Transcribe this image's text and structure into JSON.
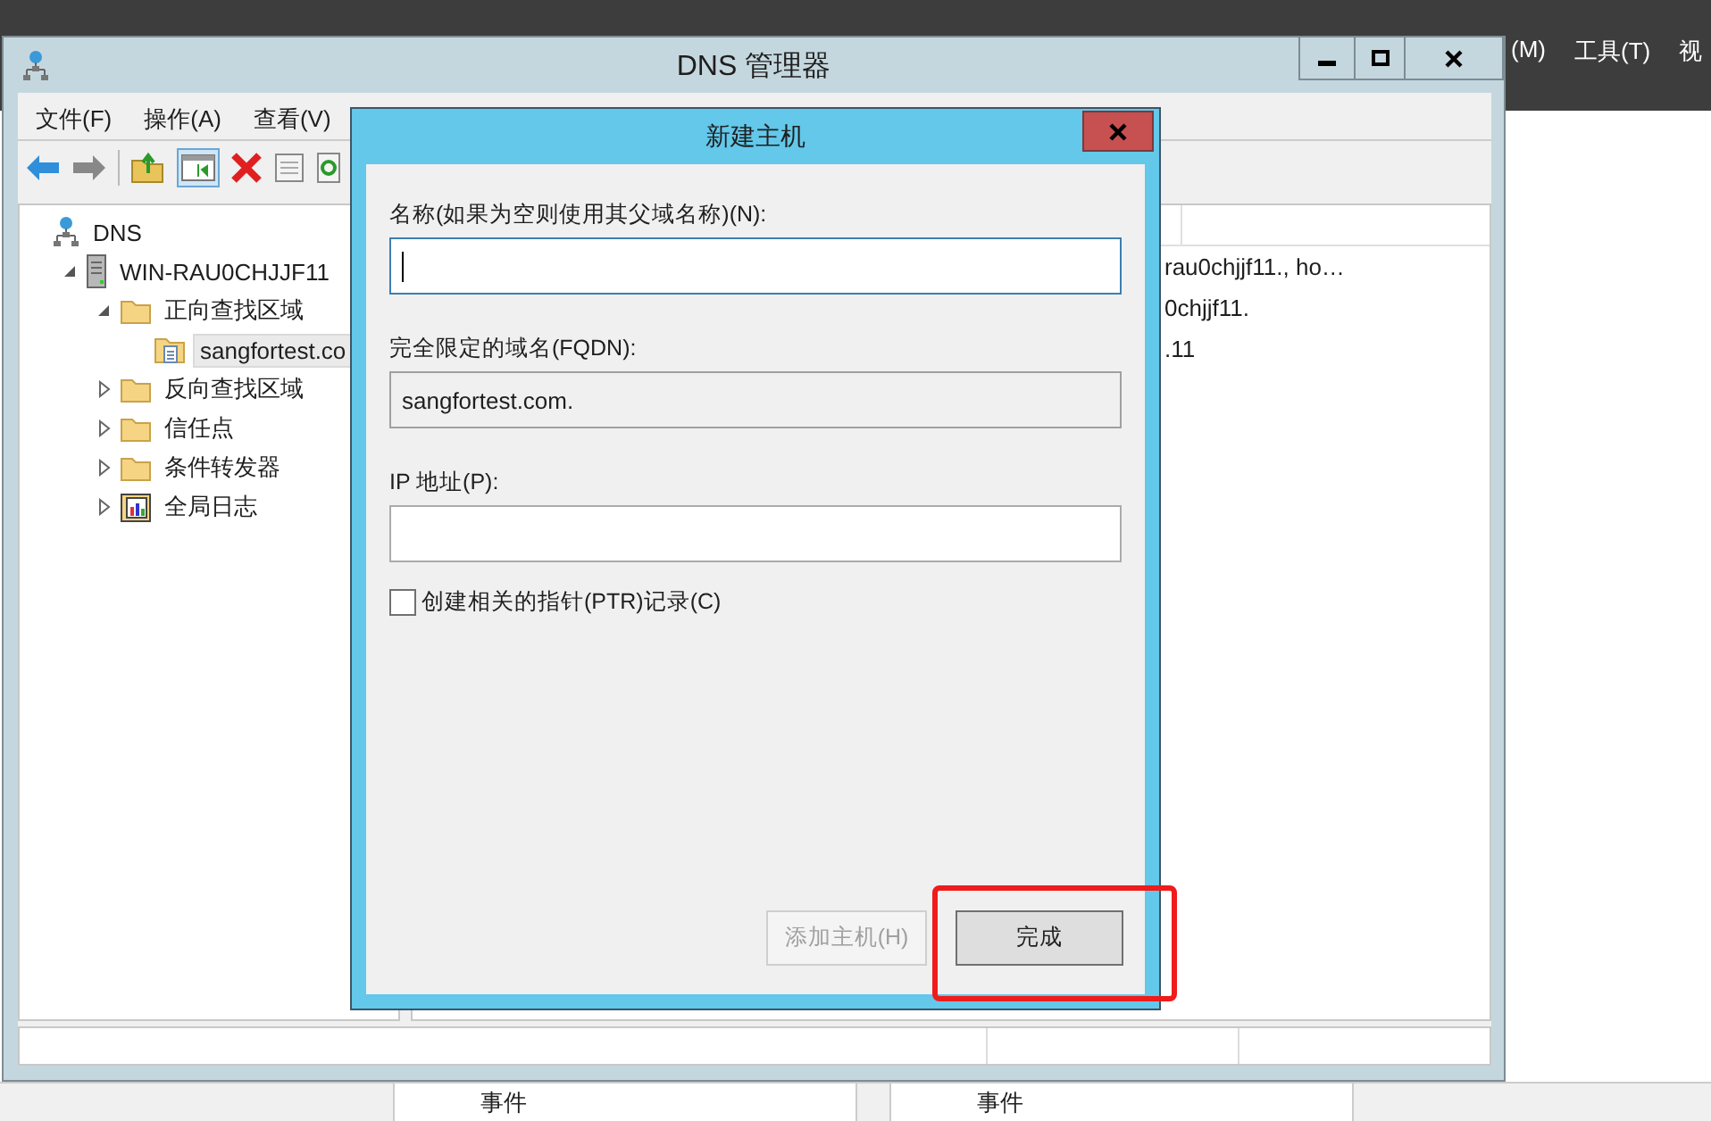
{
  "background_app": {
    "menu": [
      "(M)",
      "工具(T)",
      "视"
    ]
  },
  "window": {
    "title": "DNS 管理器"
  },
  "menu": [
    {
      "label": "文件(F)"
    },
    {
      "label": "操作(A)"
    },
    {
      "label": "查看(V)"
    }
  ],
  "tree": [
    {
      "label": "DNS",
      "kind": "dns",
      "children": [
        {
          "label": "WIN-RAU0CHJJF11",
          "kind": "server",
          "expanded": true,
          "children": [
            {
              "label": "正向查找区域",
              "kind": "folder",
              "expanded": true,
              "children": [
                {
                  "label": "sangfortest.co",
                  "kind": "zone",
                  "selected": true
                }
              ]
            },
            {
              "label": "反向查找区域",
              "kind": "folder",
              "expanded": false
            },
            {
              "label": "信任点",
              "kind": "folder",
              "expanded": false
            },
            {
              "label": "条件转发器",
              "kind": "folder",
              "expanded": false
            },
            {
              "label": "全局日志",
              "kind": "log",
              "expanded": false
            }
          ]
        }
      ]
    }
  ],
  "list": {
    "rows": [
      {
        "text": "rau0chjjf11., ho…"
      },
      {
        "text": "0chjjf11."
      },
      {
        "text": ".11"
      }
    ]
  },
  "dialog": {
    "title": "新建主机",
    "fields": [
      {
        "label": "名称(如果为空则使用其父域名称)(N):",
        "kind": "input",
        "focused": true
      },
      {
        "label": "完全限定的域名(FQDN):",
        "kind": "readonly",
        "value": "sangfortest.com."
      },
      {
        "label": "IP 地址(P):",
        "kind": "input",
        "focused": false
      }
    ],
    "checkbox": {
      "label": "创建相关的指针(PTR)记录(C)",
      "checked": false
    },
    "buttons": [
      {
        "label": "添加主机(H)",
        "disabled": true,
        "highlighted": false
      },
      {
        "label": "完成",
        "disabled": false,
        "highlighted": true
      }
    ]
  },
  "bottom_panels": [
    {
      "label": "事件"
    },
    {
      "label": "事件"
    }
  ]
}
